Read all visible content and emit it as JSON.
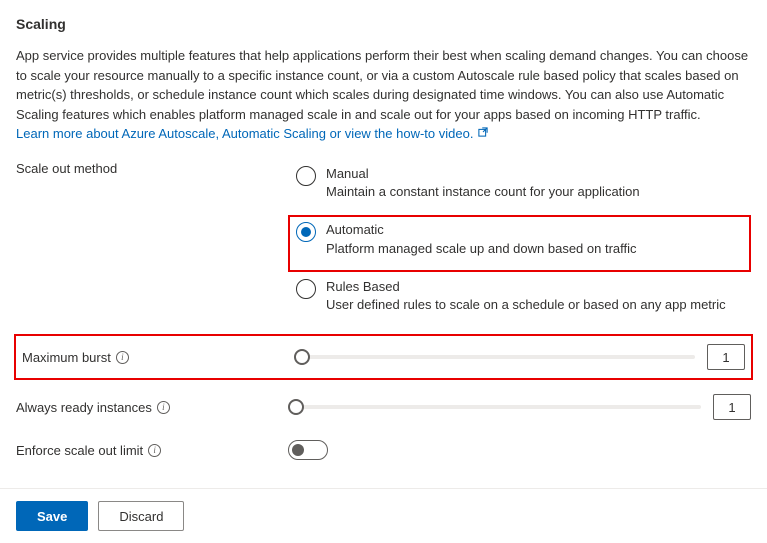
{
  "header": {
    "title": "Scaling"
  },
  "description": "App service provides multiple features that help applications perform their best when scaling demand changes. You can choose to scale your resource manually to a specific instance count, or via a custom Autoscale rule based policy that scales based on metric(s) thresholds, or schedule instance count which scales during designated time windows. You can also use Automatic Scaling features which enables platform managed scale in and scale out for your apps based on incoming HTTP traffic.",
  "learn_link": "Learn more about Azure Autoscale, Automatic Scaling or view the how-to video.",
  "labels": {
    "scale_out_method": "Scale out method",
    "maximum_burst": "Maximum burst",
    "always_ready": "Always ready instances",
    "enforce_limit": "Enforce scale out limit"
  },
  "options": {
    "manual": {
      "title": "Manual",
      "sub": "Maintain a constant instance count for your application",
      "checked": false
    },
    "automatic": {
      "title": "Automatic",
      "sub": "Platform managed scale up and down based on traffic",
      "checked": true
    },
    "rules": {
      "title": "Rules Based",
      "sub": "User defined rules to scale on a schedule or based on any app metric",
      "checked": false
    }
  },
  "values": {
    "maximum_burst": "1",
    "always_ready": "1",
    "enforce_limit": false
  },
  "footer": {
    "save": "Save",
    "discard": "Discard"
  },
  "info_glyph": "i"
}
